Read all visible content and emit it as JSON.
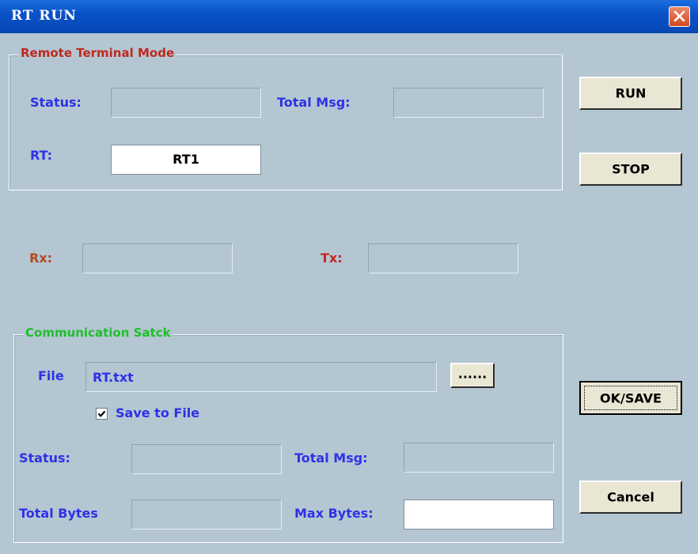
{
  "window": {
    "title": "RT RUN"
  },
  "rt_group": {
    "title": "Remote Terminal  Mode",
    "status_label": "Status:",
    "status_value": "",
    "total_msg_label": "Total Msg:",
    "total_msg_value": "",
    "rt_label": "RT:",
    "rt_value": "RT1"
  },
  "rx_label": "Rx:",
  "rx_value": "",
  "tx_label": "Tx:",
  "tx_value": "",
  "comm_group": {
    "title": "Communication  Satck",
    "file_label": "File",
    "file_value": "RT.txt",
    "browse_label": "......",
    "save_to_file_label": "Save to File",
    "save_to_file_checked": true,
    "status_label": "Status:",
    "status_value": "",
    "total_msg_label": "Total Msg:",
    "total_msg_value": "",
    "total_bytes_label": "Total Bytes",
    "total_bytes_value": "",
    "max_bytes_label": "Max Bytes:",
    "max_bytes_value": ""
  },
  "buttons": {
    "run": "RUN",
    "stop": "STOP",
    "ok_save": "OK/SAVE",
    "cancel": "Cancel"
  },
  "colors": {
    "titlebar": "#0a52c8",
    "dialog_bg": "#b3c6d2",
    "label_blue": "#2f31e6",
    "label_red": "#c0291f",
    "group_green": "#1fbf2a",
    "button_face": "#eae6d4"
  }
}
